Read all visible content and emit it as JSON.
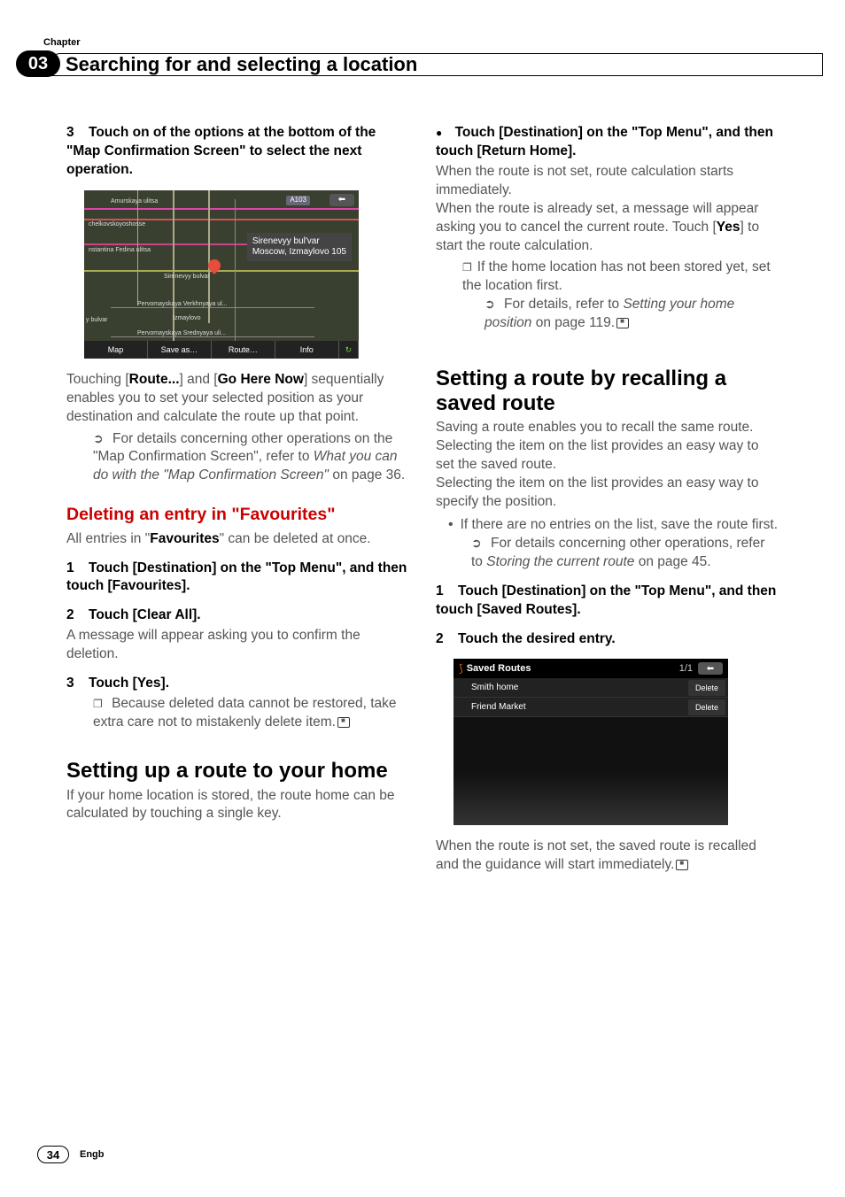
{
  "header": {
    "chapter_label": "Chapter",
    "chapter_num": "03",
    "title": "Searching for and selecting a location"
  },
  "left": {
    "step3": "3",
    "step3_text": "Touch on of the options at the bottom of the \"Map Confirmation Screen\" to select the next operation.",
    "map": {
      "road": "A103",
      "street1": "Amurskaya ulitsa",
      "street2": "chelkovskoyoshosse",
      "street3": "nstantina Fedina ulitsa",
      "street4": "Sirenevyy bulvar",
      "street5": "Pervomayskaya Verkhnyaya ul...",
      "street6": "Izmaylovo",
      "street7": "Pervomayskaya Srednyaya uli...",
      "street8": "y bulvar",
      "callout_line1": "Sirenevyy bul'var",
      "callout_line2": "Moscow, Izmaylovo 105",
      "btn_map": "Map",
      "btn_save": "Save as…",
      "btn_route": "Route…",
      "btn_info": "Info"
    },
    "p1_pre": "Touching [",
    "p1_b1": "Route...",
    "p1_mid": "] and [",
    "p1_b2": "Go Here Now",
    "p1_post": "] sequentially enables you to set your selected position as your destination and calculate the route up that point.",
    "p2": "For details concerning other operations on the \"Map Confirmation Screen\", refer to ",
    "p2_italic": "What you can do with the \"Map Confirmation Screen\"",
    "p2_end": " on page 36.",
    "sub1_a": "Deleting an entry in \"",
    "sub1_b": "Favourites",
    "sub1_c": "\"",
    "sub1_body_pre": "All entries in \"",
    "sub1_body_b": "Favourites",
    "sub1_body_post": "\" can be deleted at once.",
    "d_step1_n": "1",
    "d_step1": "Touch [Destination] on the \"Top Menu\", and then touch [Favourites].",
    "d_step2_n": "2",
    "d_step2": "Touch [Clear All].",
    "d_step2_body": "A message will appear asking you to confirm the deletion.",
    "d_step3_n": "3",
    "d_step3": "Touch [Yes].",
    "d_step3_note": "Because deleted data cannot be restored, take extra care not to mistakenly delete item.",
    "sec1": "Setting up a route to your home",
    "sec1_body": "If your home location is stored, the route home can be calculated by touching a single key."
  },
  "right": {
    "bl1": "Touch [Destination] on the \"Top Menu\", and then touch [Return Home].",
    "p1": "When the route is not set, route calculation starts immediately.",
    "p2_a": "When the route is already set, a message will appear asking you to cancel the current route. Touch [",
    "p2_b": "Yes",
    "p2_c": "] to start the route calculation.",
    "note1": "If the home location has not been stored yet, set the location first.",
    "ref1_a": "For details, refer to ",
    "ref1_i": "Setting your home position",
    "ref1_b": " on page 119.",
    "sec2": "Setting a route by recalling a saved route",
    "sec2_p1": "Saving a route enables you to recall the same route. Selecting the item on the list provides an easy way to set the saved route.",
    "sec2_p2": "Selecting the item on the list provides an easy way to specify the position.",
    "sec2_b1": "If there are no entries on the list, save the route first.",
    "sec2_ref_a": "For details concerning other operations, refer to ",
    "sec2_ref_i": "Storing the current route",
    "sec2_ref_b": " on page 45.",
    "r_step1_n": "1",
    "r_step1": "Touch [Destination] on the \"Top Menu\", and then touch [Saved Routes].",
    "r_step2_n": "2",
    "r_step2": "Touch the desired entry.",
    "saved": {
      "title": "Saved Routes",
      "page": "1/1",
      "row1": "Smith home",
      "row2": "Friend Market",
      "del": "Delete"
    },
    "p_last": "When the route is not set, the saved route is recalled and the guidance will start immediately."
  },
  "footer": {
    "page": "34",
    "lang": "Engb"
  }
}
